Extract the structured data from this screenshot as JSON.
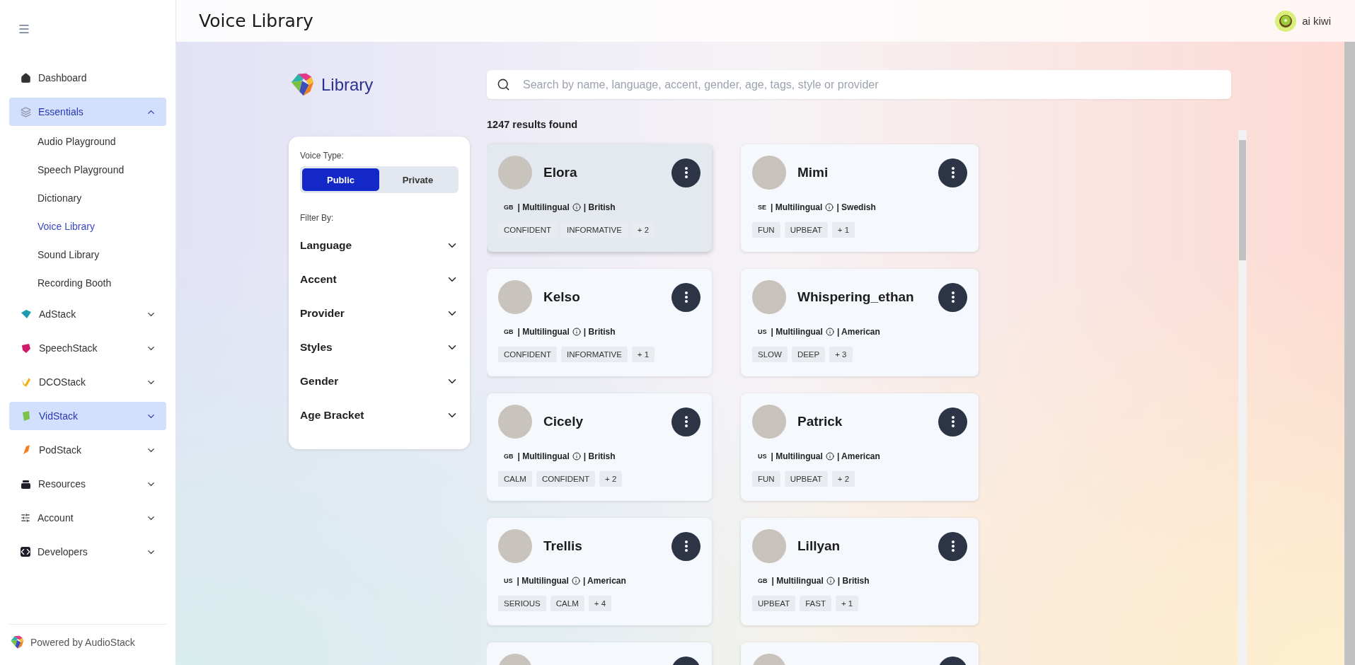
{
  "header": {
    "title": "Voice Library",
    "user": "ai kiwi"
  },
  "sidebar": {
    "items": [
      {
        "label": "Dashboard",
        "kind": "item",
        "selected": false
      },
      {
        "label": "Essentials",
        "kind": "group",
        "selected": true,
        "expanded": true,
        "children": [
          {
            "label": "Audio Playground",
            "selected": false
          },
          {
            "label": "Speech Playground",
            "selected": false
          },
          {
            "label": "Dictionary",
            "selected": false
          },
          {
            "label": "Voice Library",
            "selected": true
          },
          {
            "label": "Sound Library",
            "selected": false
          },
          {
            "label": "Recording Booth",
            "selected": false
          }
        ]
      },
      {
        "label": "AdStack",
        "kind": "group",
        "selected": false,
        "expanded": false
      },
      {
        "label": "SpeechStack",
        "kind": "group",
        "selected": false,
        "expanded": false
      },
      {
        "label": "DCOStack",
        "kind": "group",
        "selected": false,
        "expanded": false
      },
      {
        "label": "VidStack",
        "kind": "group",
        "selected": true,
        "expanded": false
      },
      {
        "label": "PodStack",
        "kind": "group",
        "selected": false,
        "expanded": false
      },
      {
        "label": "Resources",
        "kind": "group",
        "selected": false,
        "expanded": false
      },
      {
        "label": "Account",
        "kind": "group",
        "selected": false,
        "expanded": false
      },
      {
        "label": "Developers",
        "kind": "group",
        "selected": false,
        "expanded": false
      }
    ],
    "footer": "Powered by AudioStack"
  },
  "library": {
    "title": "Library"
  },
  "search": {
    "placeholder": "Search by name, language, accent, gender, age, tags, style or provider"
  },
  "results": "1247 results found",
  "filters": {
    "voice_type_label": "Voice Type:",
    "voice_types": [
      {
        "label": "Public",
        "selected": true
      },
      {
        "label": "Private",
        "selected": false
      }
    ],
    "filter_by_label": "Filter By:",
    "sections": [
      {
        "label": "Language",
        "expanded": false
      },
      {
        "label": "Accent",
        "expanded": false
      },
      {
        "label": "Provider",
        "expanded": false
      },
      {
        "label": "Styles",
        "expanded": false
      },
      {
        "label": "Gender",
        "expanded": false
      },
      {
        "label": "Age Bracket",
        "expanded": false
      }
    ]
  },
  "voices": [
    {
      "kind": "full",
      "name": "Elora",
      "flag": "GB",
      "language": "| Multilingual",
      "accent": "| British",
      "tags": [
        "CONFIDENT",
        "INFORMATIVE",
        "+ 2"
      ],
      "selected": true
    },
    {
      "kind": "full",
      "name": "Mimi",
      "flag": "SE",
      "language": "| Multilingual",
      "accent": "| Swedish",
      "tags": [
        "FUN",
        "UPBEAT",
        "+ 1"
      ],
      "selected": false
    },
    {
      "kind": "full",
      "name": "Kelso",
      "flag": "GB",
      "language": "| Multilingual",
      "accent": "| British",
      "tags": [
        "CONFIDENT",
        "INFORMATIVE",
        "+ 1"
      ],
      "selected": false
    },
    {
      "kind": "full",
      "name": "Whispering_ethan",
      "flag": "US",
      "language": "| Multilingual",
      "accent": "| American",
      "tags": [
        "SLOW",
        "DEEP",
        "+ 3"
      ],
      "selected": false
    },
    {
      "kind": "full",
      "name": "Cicely",
      "flag": "GB",
      "language": "| Multilingual",
      "accent": "| British",
      "tags": [
        "CALM",
        "CONFIDENT",
        "+ 2"
      ],
      "selected": false
    },
    {
      "kind": "full",
      "name": "Patrick",
      "flag": "US",
      "language": "| Multilingual",
      "accent": "| American",
      "tags": [
        "FUN",
        "UPBEAT",
        "+ 2"
      ],
      "selected": false
    },
    {
      "kind": "full",
      "name": "Trellis",
      "flag": "US",
      "language": "| Multilingual",
      "accent": "| American",
      "tags": [
        "SERIOUS",
        "CALM",
        "+ 4"
      ],
      "selected": false
    },
    {
      "kind": "full",
      "name": "Lillyan",
      "flag": "GB",
      "language": "| Multilingual",
      "accent": "| British",
      "tags": [
        "UPBEAT",
        "FAST",
        "+ 1"
      ],
      "selected": false
    },
    {
      "kind": "partial",
      "selected": false
    },
    {
      "kind": "partial",
      "selected": false
    }
  ]
}
